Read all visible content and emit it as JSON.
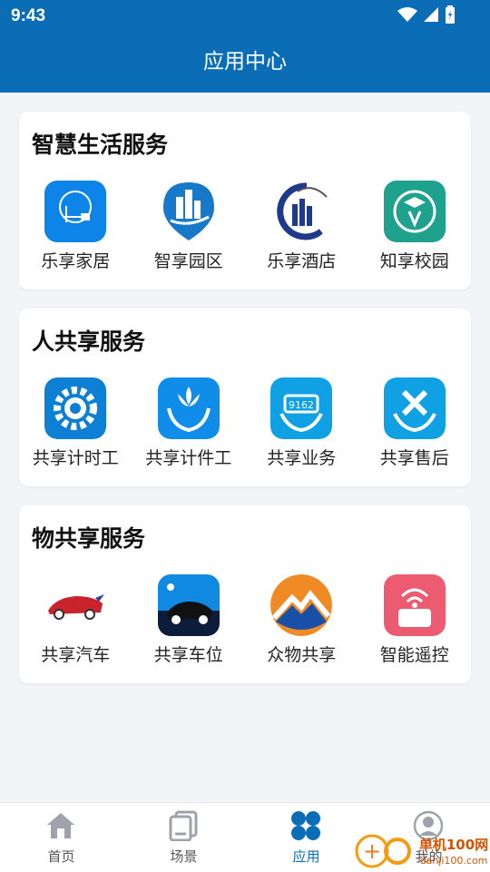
{
  "status": {
    "time": "9:43"
  },
  "header": {
    "title": "应用中心"
  },
  "sections": [
    {
      "title": "智慧生活服务",
      "apps": [
        "乐享家居",
        "智享园区",
        "乐享酒店",
        "知享校园"
      ]
    },
    {
      "title": "人共享服务",
      "apps": [
        "共享计时工",
        "共享计件工",
        "共享业务",
        "共享售后"
      ]
    },
    {
      "title": "物共享服务",
      "apps": [
        "共享汽车",
        "共享车位",
        "众物共享",
        "智能遥控"
      ]
    }
  ],
  "tabs": [
    {
      "label": "首页",
      "icon": "home-icon"
    },
    {
      "label": "场景",
      "icon": "scenes-icon"
    },
    {
      "label": "应用",
      "icon": "apps-icon",
      "active": true
    },
    {
      "label": "我的",
      "icon": "profile-icon"
    }
  ],
  "watermark": {
    "text": "单机100网",
    "url": "danji100.com"
  },
  "colors": {
    "primary": "#0a6db5",
    "background": "#f3f4f8",
    "card": "#ffffff"
  }
}
